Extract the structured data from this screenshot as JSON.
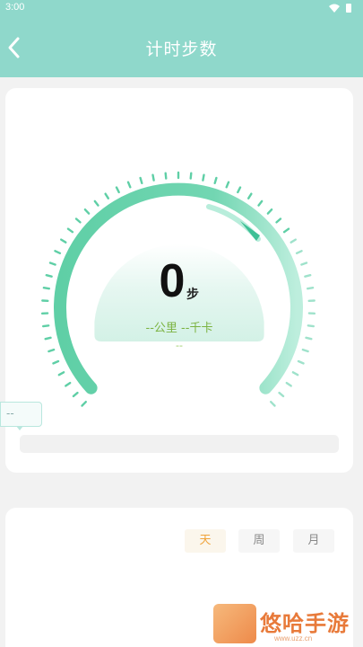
{
  "status_bar": {
    "time": "3:00",
    "icons": [
      "wifi-icon",
      "battery-icon"
    ]
  },
  "header": {
    "title": "计时步数",
    "back_icon": "chevron-left-icon",
    "background": "#8fd8cb"
  },
  "gauge": {
    "steps": "0",
    "steps_unit": "步",
    "distance_calories": "--公里 --千卡",
    "sub_value": "--",
    "accent": "#6fd3b5",
    "progress": 0
  },
  "chart_tooltip": {
    "value": "--"
  },
  "period_tabs": [
    {
      "label": "天",
      "active": true
    },
    {
      "label": "周",
      "active": false
    },
    {
      "label": "月",
      "active": false
    }
  ],
  "watermark": {
    "text": "悠哈手游",
    "url": "www.uzz.cn"
  }
}
